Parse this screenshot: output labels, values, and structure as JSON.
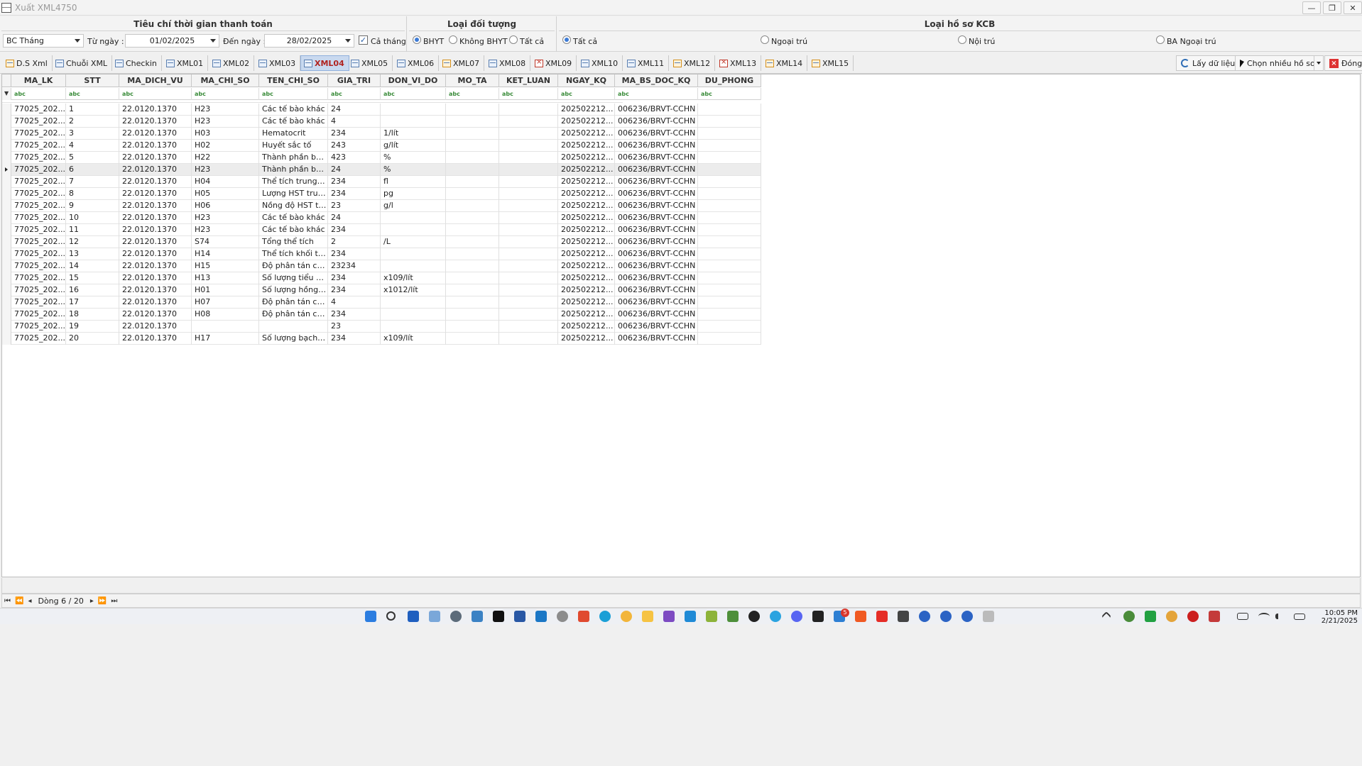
{
  "window": {
    "title": "Xuất XML4750",
    "min": "—",
    "max": "❐",
    "close": "✕"
  },
  "filters": {
    "time_group_title": "Tiêu chí thời gian thanh toán",
    "report_type": "BC Tháng",
    "from_label": "Từ ngày :",
    "from_date": "01/02/2025",
    "to_label": "Đến ngày :",
    "to_date": "28/02/2025",
    "whole_month_label": "Cả tháng",
    "whole_month_checked": true,
    "object_group_title": "Loại đối tượng",
    "object_options": [
      "BHYT",
      "Không BHYT",
      "Tất cả"
    ],
    "object_selected": "BHYT",
    "record_group_title": "Loại hồ sơ KCB",
    "record_options": [
      "Tất cả",
      "Ngoại trú",
      "Nội trú",
      "BA Ngoại trú"
    ],
    "record_selected": "Tất cả"
  },
  "tabs": [
    "D.S Xml",
    "Chuỗi XML",
    "Checkin",
    "XML01",
    "XML02",
    "XML03",
    "XML04",
    "XML05",
    "XML06",
    "XML07",
    "XML08",
    "XML09",
    "XML10",
    "XML11",
    "XML12",
    "XML13",
    "XML14",
    "XML15"
  ],
  "active_tab": "XML04",
  "actions": {
    "fetch": "Lấy dữ liệu",
    "choose_many": "Chọn nhiều hồ sơ",
    "close": "Đóng"
  },
  "grid": {
    "columns": [
      "MA_LK",
      "STT",
      "MA_DICH_VU",
      "MA_CHI_SO",
      "TEN_CHI_SO",
      "GIA_TRI",
      "DON_VI_DO",
      "MO_TA",
      "KET_LUAN",
      "NGAY_KQ",
      "MA_BS_DOC_KQ",
      "DU_PHONG"
    ],
    "filter_icon": "abc",
    "current_row": 6,
    "rows": [
      [
        "77025_202...",
        "1",
        "22.0120.1370",
        "H23",
        "Các tế bào khác",
        "24",
        "",
        "",
        "",
        "202502212...",
        "006236/BRVT-CCHN",
        ""
      ],
      [
        "77025_202...",
        "2",
        "22.0120.1370",
        "H23",
        "Các tế bào khác",
        "4",
        "",
        "",
        "",
        "202502212...",
        "006236/BRVT-CCHN",
        ""
      ],
      [
        "77025_202...",
        "3",
        "22.0120.1370",
        "H03",
        "Hematocrit",
        "234",
        "1/lít",
        "",
        "",
        "202502212...",
        "006236/BRVT-CCHN",
        ""
      ],
      [
        "77025_202...",
        "4",
        "22.0120.1370",
        "H02",
        "Huyết sắc tố",
        "243",
        "g/lít",
        "",
        "",
        "202502212...",
        "006236/BRVT-CCHN",
        ""
      ],
      [
        "77025_202...",
        "5",
        "22.0120.1370",
        "H22",
        "Thành phần bạ...",
        "423",
        "%",
        "",
        "",
        "202502212...",
        "006236/BRVT-CCHN",
        ""
      ],
      [
        "77025_202...",
        "6",
        "22.0120.1370",
        "H23",
        "Thành phần bạ...",
        "24",
        "%",
        "",
        "",
        "202502212...",
        "006236/BRVT-CCHN",
        ""
      ],
      [
        "77025_202...",
        "7",
        "22.0120.1370",
        "H04",
        "Thể tích trung b...",
        "234",
        "fl",
        "",
        "",
        "202502212...",
        "006236/BRVT-CCHN",
        ""
      ],
      [
        "77025_202...",
        "8",
        "22.0120.1370",
        "H05",
        "Lượng HST trun...",
        "234",
        "pg",
        "",
        "",
        "202502212...",
        "006236/BRVT-CCHN",
        ""
      ],
      [
        "77025_202...",
        "9",
        "22.0120.1370",
        "H06",
        "Nồng độ HST tr...",
        "23",
        "g/l",
        "",
        "",
        "202502212...",
        "006236/BRVT-CCHN",
        ""
      ],
      [
        "77025_202...",
        "10",
        "22.0120.1370",
        "H23",
        "Các tế bào khác",
        "24",
        "",
        "",
        "",
        "202502212...",
        "006236/BRVT-CCHN",
        ""
      ],
      [
        "77025_202...",
        "11",
        "22.0120.1370",
        "H23",
        "Các tế bào khác",
        "234",
        "",
        "",
        "",
        "202502212...",
        "006236/BRVT-CCHN",
        ""
      ],
      [
        "77025_202...",
        "12",
        "22.0120.1370",
        "S74",
        "Tổng thể tích",
        "2",
        "/L",
        "",
        "",
        "202502212...",
        "006236/BRVT-CCHN",
        ""
      ],
      [
        "77025_202...",
        "13",
        "22.0120.1370",
        "H14",
        "Thể tích khối tiể...",
        "234",
        "",
        "",
        "",
        "202502212...",
        "006236/BRVT-CCHN",
        ""
      ],
      [
        "77025_202...",
        "14",
        "22.0120.1370",
        "H15",
        "Độ phân tán củ...",
        "23234",
        "",
        "",
        "",
        "202502212...",
        "006236/BRVT-CCHN",
        ""
      ],
      [
        "77025_202...",
        "15",
        "22.0120.1370",
        "H13",
        "Số lượng tiểu cầu",
        "234",
        "x109/lít",
        "",
        "",
        "202502212...",
        "006236/BRVT-CCHN",
        ""
      ],
      [
        "77025_202...",
        "16",
        "22.0120.1370",
        "H01",
        "Số lượng hồng ...",
        "234",
        "x1012/lít",
        "",
        "",
        "202502212...",
        "006236/BRVT-CCHN",
        ""
      ],
      [
        "77025_202...",
        "17",
        "22.0120.1370",
        "H07",
        "Độ phân tán củ...",
        "4",
        "",
        "",
        "",
        "202502212...",
        "006236/BRVT-CCHN",
        ""
      ],
      [
        "77025_202...",
        "18",
        "22.0120.1370",
        "H08",
        "Độ phân tán củ...",
        "234",
        "",
        "",
        "",
        "202502212...",
        "006236/BRVT-CCHN",
        ""
      ],
      [
        "77025_202...",
        "19",
        "22.0120.1370",
        "",
        "",
        "23",
        "",
        "",
        "",
        "202502212...",
        "006236/BRVT-CCHN",
        ""
      ],
      [
        "77025_202...",
        "20",
        "22.0120.1370",
        "H17",
        "Số lượng bạch cầu",
        "234",
        "x109/lít",
        "",
        "",
        "202502212...",
        "006236/BRVT-CCHN",
        ""
      ]
    ]
  },
  "navigator": {
    "first": "⏮",
    "prev_page": "⏪",
    "prev": "◂",
    "text": "Dòng 6 / 20",
    "next": "▸",
    "next_page": "⏩",
    "last": "⏭"
  },
  "taskbar": {
    "time": "10:05 PM",
    "date": "2/21/2025",
    "badge": "5"
  }
}
